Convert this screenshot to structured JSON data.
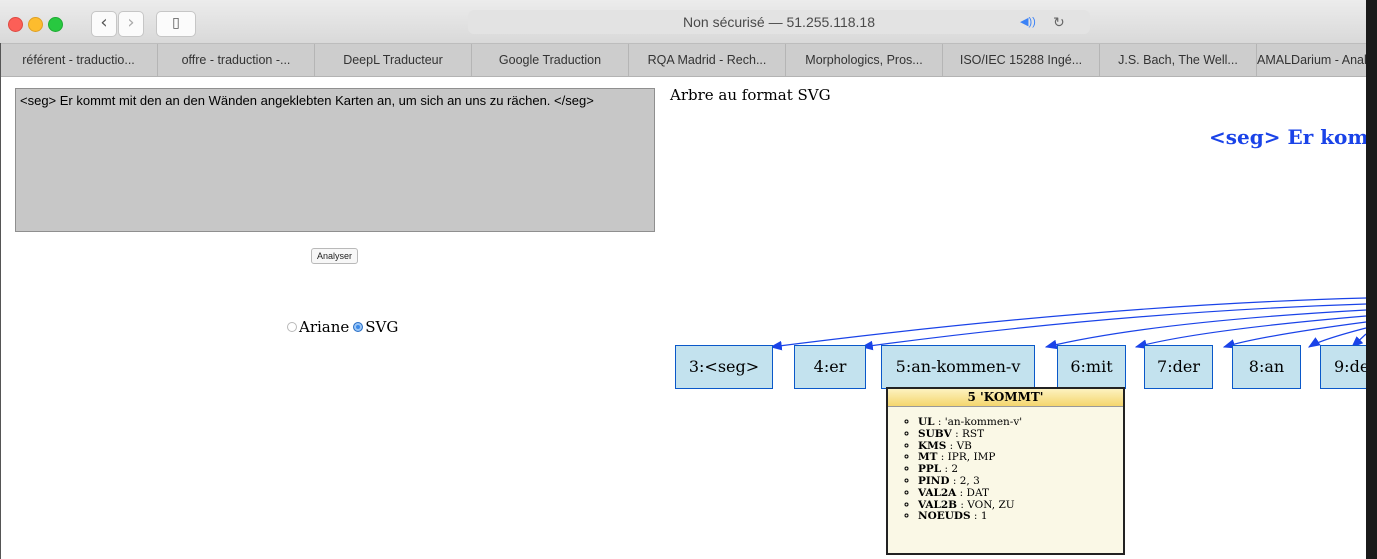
{
  "browser": {
    "url_text": "Non sécurisé — 51.255.118.18",
    "back_label": "‹",
    "forward_label": "›",
    "sidebar_label": "▯",
    "audio_label": "◀))",
    "reload_label": "↻"
  },
  "bookmarks": [
    "référent - traductio...",
    "offre - traduction -...",
    "DeepL Traducteur",
    "Google Traduction",
    "RQA Madrid - Rech...",
    "Morphologics, Pros...",
    "ISO/IEC 15288 Ingé...",
    "J.S. Bach, The Well...",
    "AMALDarium - Anal..."
  ],
  "form": {
    "input_text": "<seg> Er kommt mit den an den Wänden angeklebten Karten an, um sich an uns zu rächen. </seg>",
    "analyse_label": "Analyser",
    "radio_ariane": "Ariane",
    "radio_svg": "SVG",
    "selected": "SVG"
  },
  "tree": {
    "heading": "Arbre au format SVG",
    "segment_title": "<seg> Er komm",
    "nodes": [
      "3:<seg>",
      "4:er",
      "5:an-kommen-v",
      "6:mit",
      "7:der",
      "8:an",
      "9:de"
    ]
  },
  "popup": {
    "title": "5 'KOMMT'",
    "props": [
      {
        "key": "UL",
        "value": "'an-kommen-v'"
      },
      {
        "key": "SUBV",
        "value": "RST"
      },
      {
        "key": "KMS",
        "value": "VB"
      },
      {
        "key": "MT",
        "value": "IPR, IMP"
      },
      {
        "key": "PPL",
        "value": "2"
      },
      {
        "key": "PIND",
        "value": "2, 3"
      },
      {
        "key": "VAL2A",
        "value": "DAT"
      },
      {
        "key": "VAL2B",
        "value": "VON, ZU"
      },
      {
        "key": "NOEUDS",
        "value": "1"
      }
    ]
  },
  "colors": {
    "node_fill": "#c3e2ee",
    "edge": "#1a43e8",
    "popup_head": "#f4d66e"
  }
}
